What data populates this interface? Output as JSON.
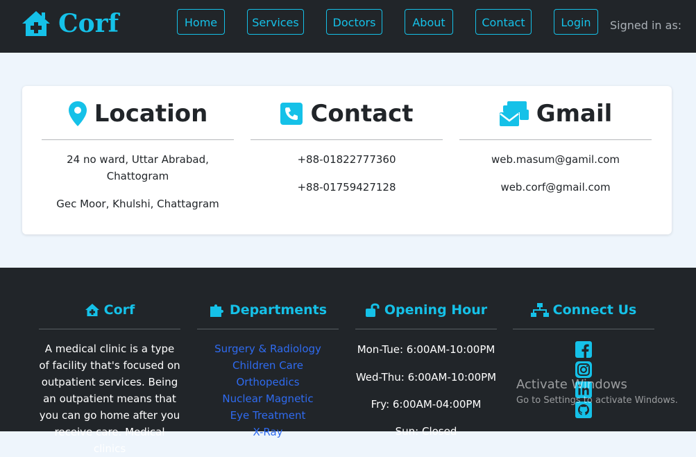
{
  "navbar": {
    "brand": "Corf",
    "links": [
      "Home",
      "Services",
      "Doctors",
      "About",
      "Contact",
      "Login"
    ],
    "signed_in": "Signed in as:"
  },
  "info": {
    "location": {
      "title": "Location",
      "lines": [
        "24 no ward, Uttar Abrabad, Chattogram",
        "Gec Moor, Khulshi, Chattagram"
      ]
    },
    "contact": {
      "title": "Contact",
      "lines": [
        "+88-01822777360",
        "+88-01759427128"
      ]
    },
    "gmail": {
      "title": "Gmail",
      "lines": [
        "web.masum@gamil.com",
        "web.corf@gmail.com"
      ]
    }
  },
  "footer": {
    "corf": {
      "title": "Corf",
      "text": "A medical clinic is a type of facility that's focused on outpatient services. Being an outpatient means that you can go home after you receive care. Medical clinics"
    },
    "departments": {
      "title": "Departments",
      "items": [
        "Surgery & Radiology",
        "Children Care",
        "Orthopedics",
        "Nuclear Magnetic",
        "Eye Treatment",
        "X-Ray"
      ]
    },
    "hours": {
      "title": "Opening Hour",
      "items": [
        "Mon-Tue: 6:00AM-10:00PM",
        "Wed-Thu: 6:00AM-10:00PM",
        "Fry: 6:00AM-04:00PM",
        "Sun: Closed"
      ]
    },
    "connect": {
      "title": "Connect Us",
      "icons": [
        "facebook-icon",
        "instagram-icon",
        "linkedin-icon",
        "github-icon"
      ]
    }
  },
  "watermark": {
    "title": "Activate Windows",
    "subtitle": "Go to Settings to activate Windows."
  },
  "colors": {
    "accent": "#15c1e8",
    "dark": "#212529",
    "link_blue": "#2f6bf0",
    "page_bg": "#eef5fc"
  }
}
